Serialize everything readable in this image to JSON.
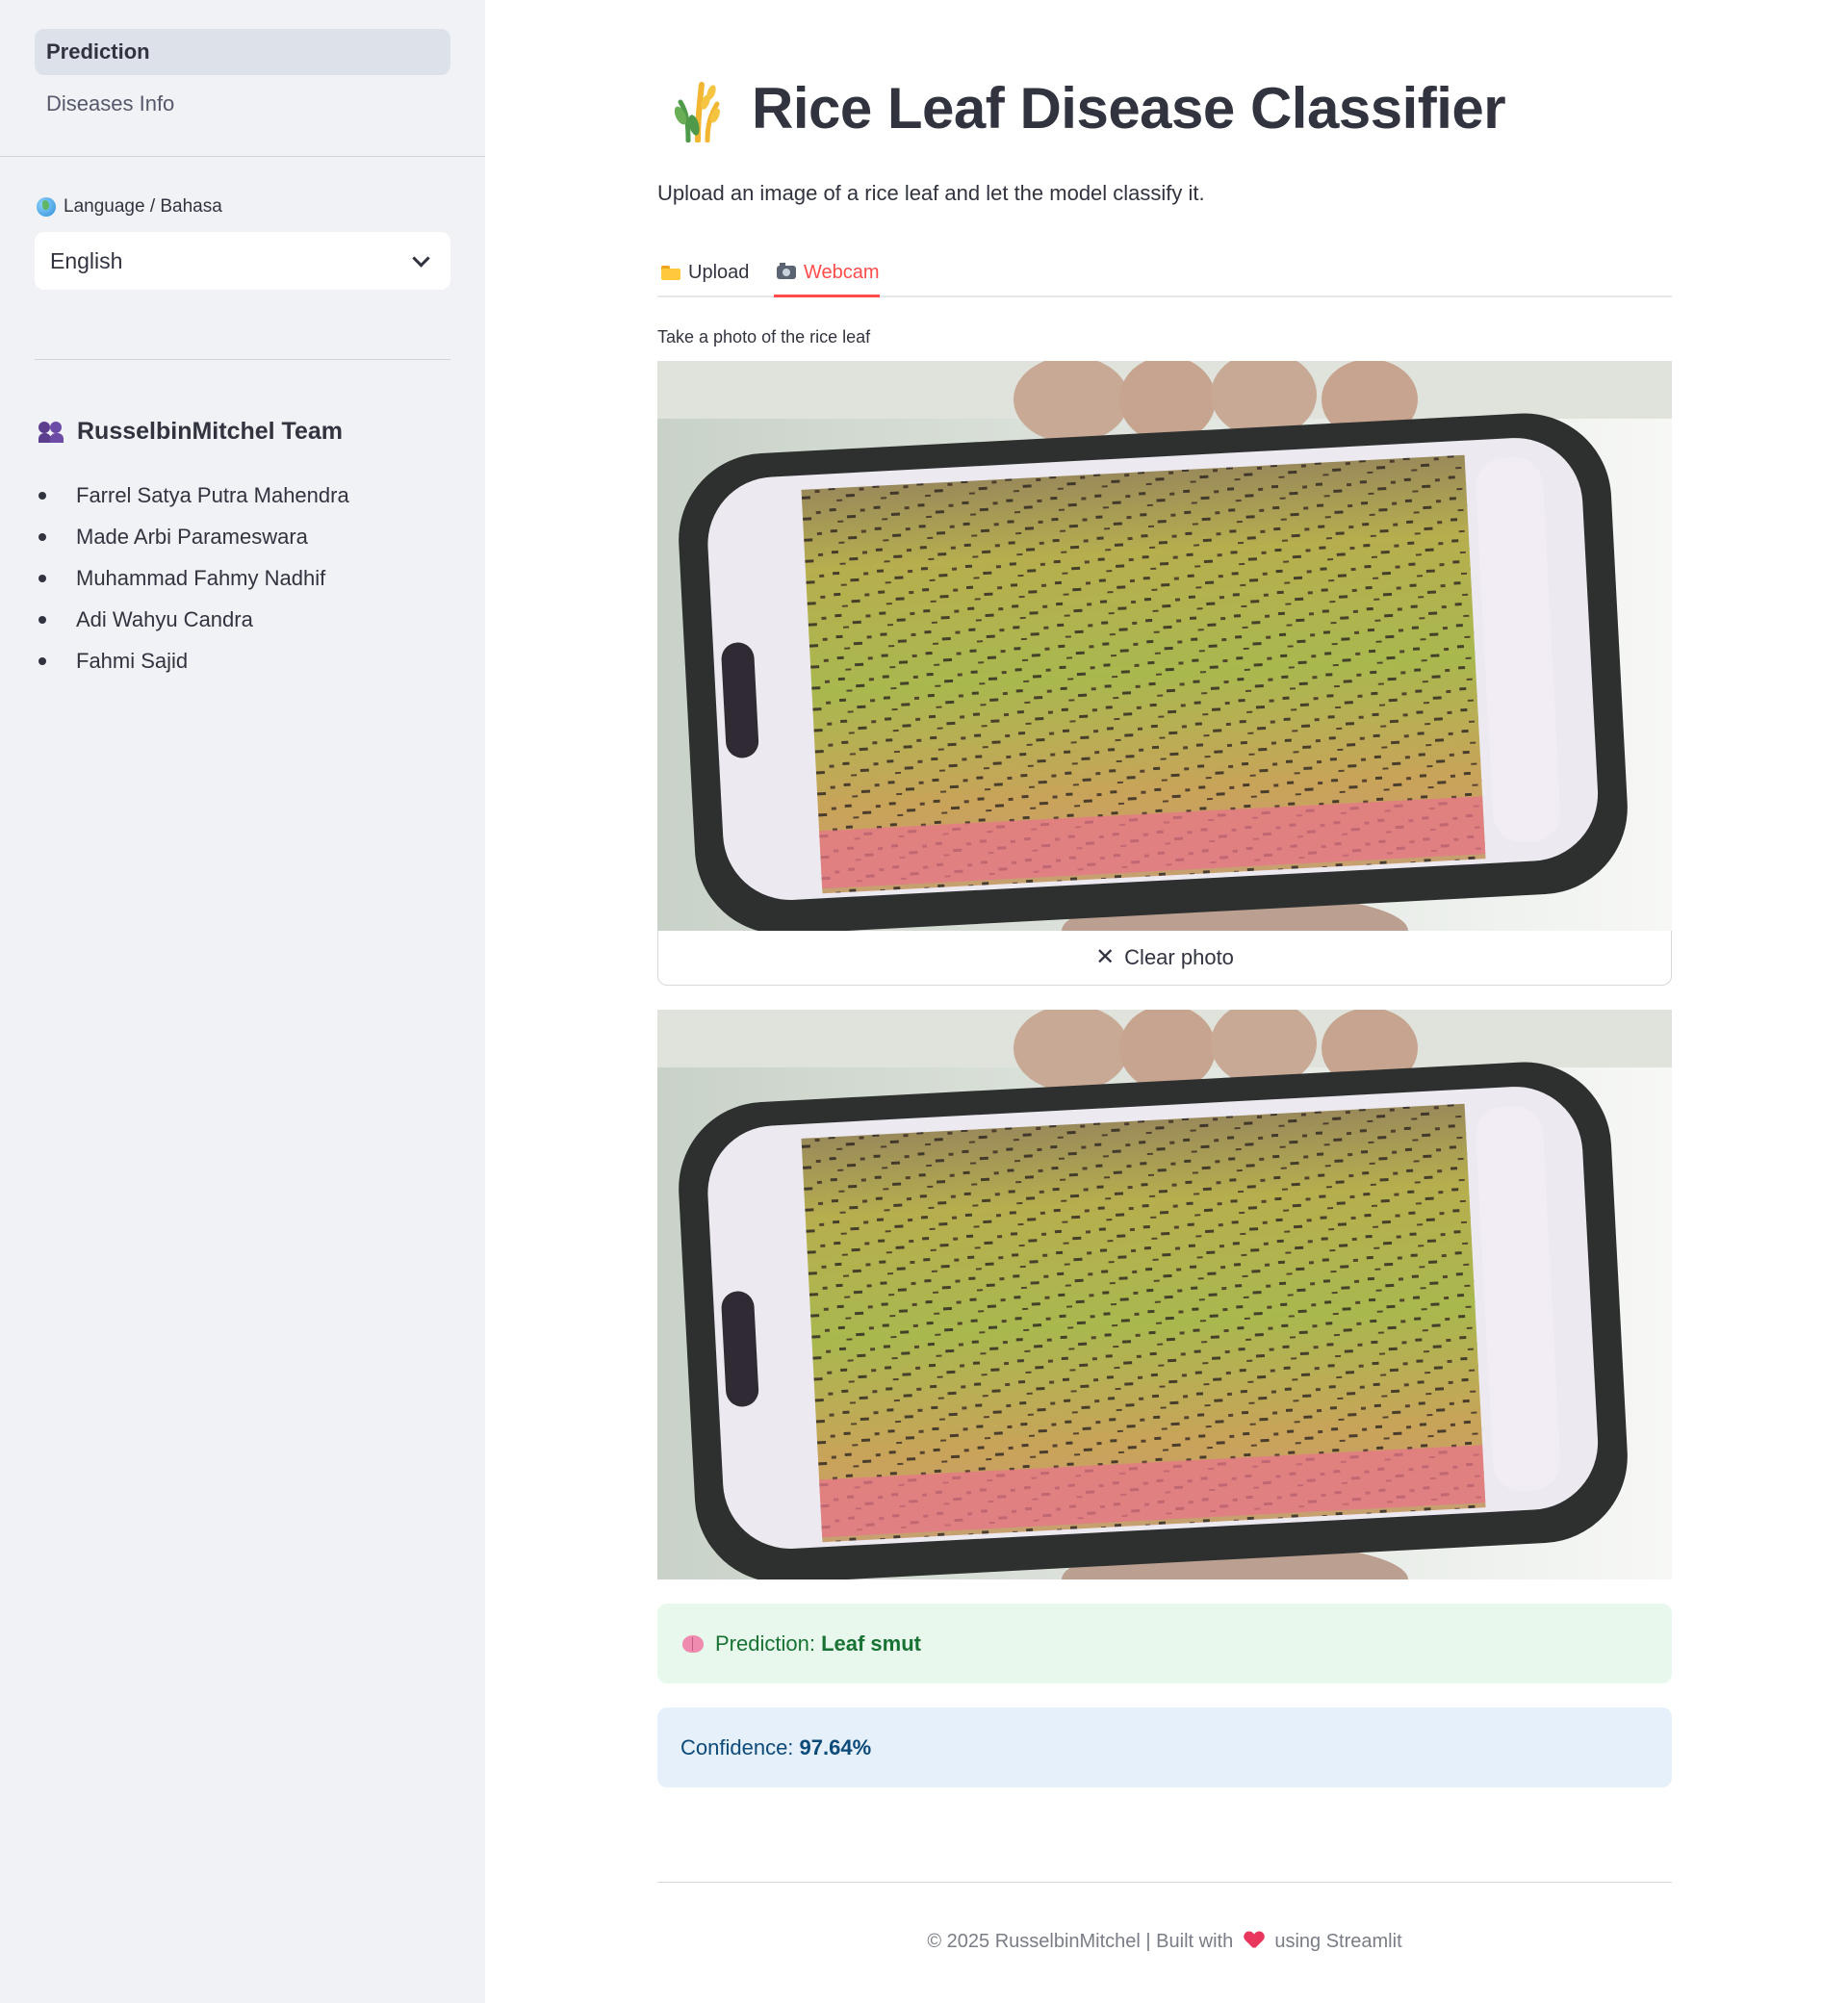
{
  "sidebar": {
    "nav": [
      {
        "label": "Prediction",
        "active": true
      },
      {
        "label": "Diseases Info",
        "active": false
      }
    ],
    "language": {
      "label": "Language / Bahasa",
      "icon": "globe-icon",
      "selected": "English"
    },
    "team": {
      "title": "RusselbinMitchel Team",
      "icon": "team-icon",
      "members": [
        "Farrel Satya Putra Mahendra",
        "Made Arbi Parameswara",
        "Muhammad Fahmy Nadhif",
        "Adi Wahyu Candra",
        "Fahmi Sajid"
      ]
    }
  },
  "main": {
    "title": "Rice Leaf Disease Classifier",
    "subtitle": "Upload an image of a rice leaf and let the model classify it.",
    "tabs": [
      {
        "label": "Upload",
        "icon": "folder-icon",
        "active": false
      },
      {
        "label": "Webcam",
        "icon": "camera-icon",
        "active": true
      }
    ],
    "camera": {
      "label": "Take a photo of the rice leaf",
      "clear_label": "Clear photo"
    },
    "result": {
      "prediction_prefix": "Prediction: ",
      "prediction_value": "Leaf smut",
      "confidence_prefix": "Confidence: ",
      "confidence_value": "97.64%"
    },
    "footer": {
      "left": "© 2025 RusselbinMitchel | Built with",
      "right": "using Streamlit"
    }
  },
  "colors": {
    "accent": "#ff4b4b",
    "sidebar_bg": "#f0f2f6",
    "success_bg": "#e8f8ec",
    "success_text": "#177233",
    "info_bg": "#e6f0fb",
    "info_text": "#0c4a7a"
  }
}
